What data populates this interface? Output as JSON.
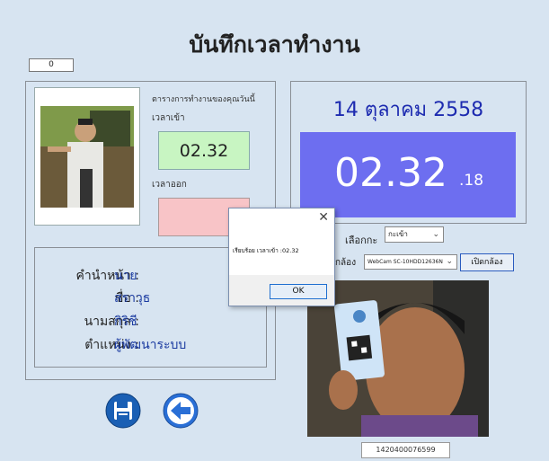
{
  "window": {
    "title": "บันทึกเวลาทำงาน",
    "counter": "0"
  },
  "schedule": {
    "heading": "ตารางการทำงานของคุณวันนี้",
    "time_in_label": "เวลาเข้า",
    "time_in_value": "02.32",
    "time_out_label": "เวลาออก",
    "time_out_value": ""
  },
  "employee": {
    "prefix_label": "คำนำหน้า :",
    "prefix_value": "นาย",
    "name_label": "ชื่อ :",
    "name_value": "สราวุธ",
    "surname_label": "นามสกุล :",
    "surname_value": "กิริชี",
    "position_label": "ตำแหน่ง :",
    "position_value": "ผู้พัฒนาระบบ"
  },
  "clock": {
    "date": "14 ตุลาคม 2558",
    "time_main": "02.32",
    "time_seconds": ".18",
    "bg_color": "#6d6ef0"
  },
  "controls": {
    "select_label": "เลือกกะ",
    "select_value": "กะเข้า",
    "camera_label": "กล้อง",
    "camera_value": "WebCam SC-10HDD12636N",
    "open_camera_button": "เปิดกล้อง"
  },
  "scan_id": "1420400076599",
  "dialog": {
    "message": "เรียบร้อย เวลาเข้า :02.32",
    "ok_label": "OK"
  },
  "buttons": {
    "save_icon": "floppy-disk-icon",
    "back_icon": "back-arrow-icon"
  }
}
